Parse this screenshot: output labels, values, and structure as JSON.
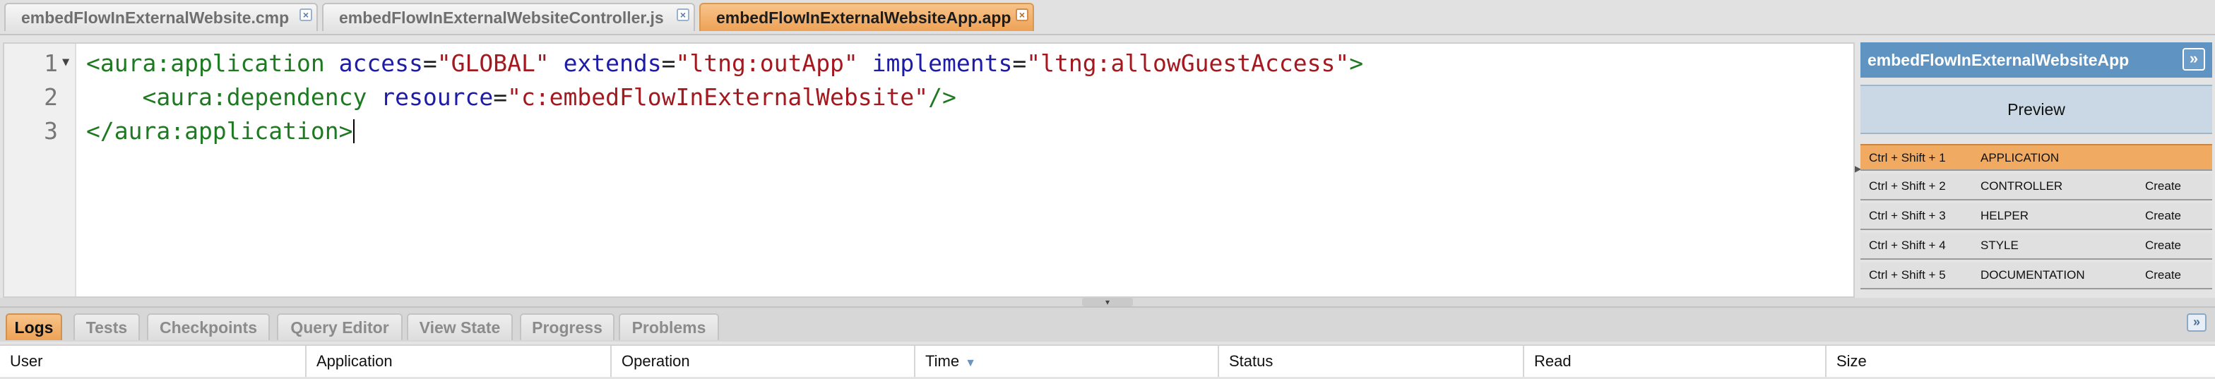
{
  "editor_tabs": [
    {
      "label": "embedFlowInExternalWebsite.cmp",
      "active": false
    },
    {
      "label": "embedFlowInExternalWebsiteController.js",
      "active": false
    },
    {
      "label": "embedFlowInExternalWebsiteApp.app",
      "active": true
    }
  ],
  "code": {
    "line_numbers": [
      "1",
      "2",
      "3"
    ],
    "line1": {
      "open": "<aura:application",
      "a1": "access",
      "v1": "\"GLOBAL\"",
      "a2": "extends",
      "v2": "\"ltng:outApp\"",
      "a3": "implements",
      "v3": "\"ltng:allowGuestAccess\"",
      "close": ">"
    },
    "line2": {
      "indent": "    ",
      "open": "<aura:dependency",
      "a1": "resource",
      "v1": "\"c:embedFlowInExternalWebsite\"",
      "close": "/>"
    },
    "line3": {
      "tag": "</aura:application>"
    }
  },
  "side_panel": {
    "title": "embedFlowInExternalWebsiteApp",
    "preview_label": "Preview",
    "shortcuts": [
      {
        "keys": "Ctrl + Shift + 1",
        "name": "APPLICATION",
        "action": "",
        "active": true
      },
      {
        "keys": "Ctrl + Shift + 2",
        "name": "CONTROLLER",
        "action": "Create",
        "active": false
      },
      {
        "keys": "Ctrl + Shift + 3",
        "name": "HELPER",
        "action": "Create",
        "active": false
      },
      {
        "keys": "Ctrl + Shift + 4",
        "name": "STYLE",
        "action": "Create",
        "active": false
      },
      {
        "keys": "Ctrl + Shift + 5",
        "name": "DOCUMENTATION",
        "action": "Create",
        "active": false
      }
    ]
  },
  "bottom_tabs": [
    "Logs",
    "Tests",
    "Checkpoints",
    "Query Editor",
    "View State",
    "Progress",
    "Problems"
  ],
  "log_columns": [
    "User",
    "Application",
    "Operation",
    "Time",
    "Status",
    "Read",
    "Size"
  ],
  "colors": {
    "accent_orange": "#eea256",
    "panel_blue": "#5f93c1"
  }
}
